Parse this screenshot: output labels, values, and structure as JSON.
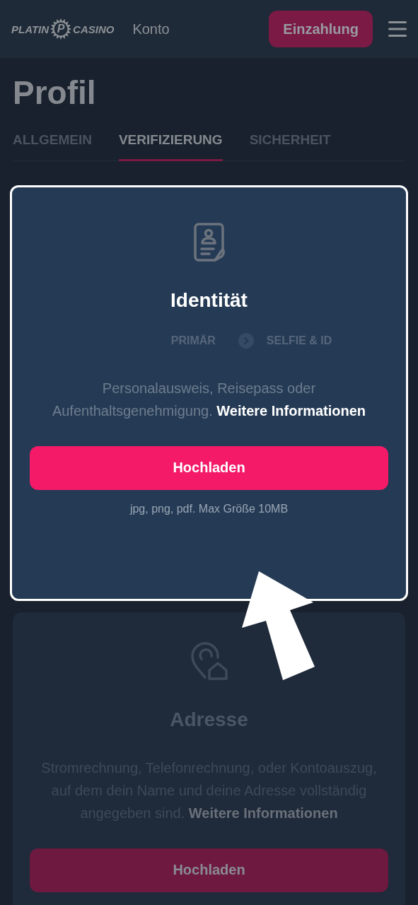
{
  "header": {
    "logo": {
      "left": "PLATIN",
      "badge": "P",
      "right": "CASINO"
    },
    "nav_link": "Konto",
    "deposit_button": "Einzahlung"
  },
  "page_title": "Profil",
  "tabs": [
    {
      "label": "ALLGEMEIN",
      "selected": false
    },
    {
      "label": "VERIFIZIERUNG",
      "selected": true
    },
    {
      "label": "SICHERHEIT",
      "selected": false
    }
  ],
  "cards": [
    {
      "kind": "identity",
      "highlighted": true,
      "title": "Identität",
      "steps": [
        "PRIMÄR",
        "SELFIE & ID"
      ],
      "description": "Personalausweis, Reisepass oder Aufenthaltsgenehmigung.",
      "link": "Weitere Informationen",
      "button": "Hochladen",
      "note": "jpg, png, pdf. Max Größe 10MB"
    },
    {
      "kind": "address",
      "highlighted": false,
      "title": "Adresse",
      "description": "Stromrechnung, Telefonrechnung, oder Kontoauszug, auf dem dein Name und deine Adresse vollständig angegeben sind.",
      "link": "Weitere Informationen",
      "button": "Hochladen"
    }
  ]
}
